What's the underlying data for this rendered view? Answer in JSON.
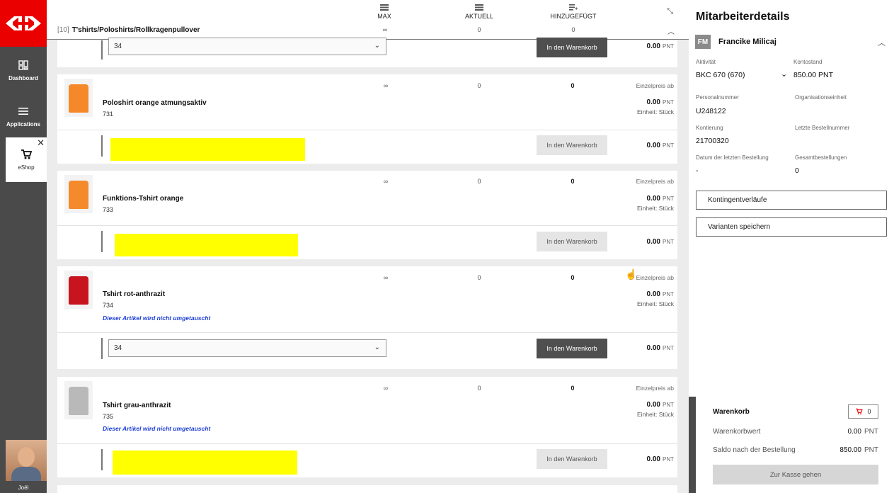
{
  "sidebar": {
    "items": [
      {
        "label": "Dashboard",
        "icon": "dashboard-icon"
      },
      {
        "label": "Applications",
        "icon": "menu-icon"
      },
      {
        "label": "eShop",
        "icon": "cart-icon"
      }
    ],
    "user_name": "Joël"
  },
  "columns": {
    "max": "MAX",
    "aktuell": "AKTUELL",
    "hinzugefuegt": "HINZUGEFÜGT"
  },
  "category": {
    "count": "[10]",
    "title": "T'shirts/Poloshirts/Rollkragenpullover",
    "max": "∞",
    "aktuell": "0",
    "hinzugefuegt": "0"
  },
  "top_partial": {
    "select_value": "34",
    "button": "In den Warenkorb",
    "price": "0.00",
    "unit": "PNT"
  },
  "products": [
    {
      "name": "Poloshirt orange atmungsaktiv",
      "number": "731",
      "max": "∞",
      "aktuell": "0",
      "hinzugefuegt": "0",
      "price_label": "Einzelpreis ab",
      "price": "0.00",
      "currency": "PNT",
      "unit": "Einheit: Stück",
      "note": "",
      "button": "In den Warenkorb",
      "line_price": "0.00",
      "color": "#f5892a"
    },
    {
      "name": "Funktions-Tshirt orange",
      "number": "733",
      "max": "∞",
      "aktuell": "0",
      "hinzugefuegt": "0",
      "price_label": "Einzelpreis ab",
      "price": "0.00",
      "currency": "PNT",
      "unit": "Einheit: Stück",
      "note": "",
      "button": "In den Warenkorb",
      "line_price": "0.00",
      "color": "#f58a2c"
    },
    {
      "name": "Tshirt rot-anthrazit",
      "number": "734",
      "max": "∞",
      "aktuell": "0",
      "hinzugefuegt": "0",
      "price_label": "Einzelpreis ab",
      "price": "0.00",
      "currency": "PNT",
      "unit": "Einheit: Stück",
      "note": "Dieser Artikel wird nicht umgetauscht",
      "button": "In den Warenkorb",
      "select_value": "34",
      "line_price": "0.00",
      "color": "#c8141e"
    },
    {
      "name": "Tshirt grau-anthrazit",
      "number": "735",
      "max": "∞",
      "aktuell": "0",
      "hinzugefuegt": "0",
      "price_label": "Einzelpreis ab",
      "price": "0.00",
      "currency": "PNT",
      "unit": "Einheit: Stück",
      "note": "Dieser Artikel wird nicht umgetauscht",
      "button": "In den Warenkorb",
      "line_price": "0.00",
      "color": "#b9b9b9"
    }
  ],
  "panel": {
    "title": "Mitarbeiterdetails",
    "initials": "FM",
    "employee_name": "Francike  Milicaj",
    "aktivitaet_label": "Aktivität",
    "aktivitaet_value": "BKC 670 (670)",
    "kontostand_label": "Kontostand",
    "kontostand_value": "850.00  PNT",
    "personalnummer_label": "Personalnummer",
    "personalnummer_value": "U248122",
    "organisationseinheit_label": "Organisationseinheit",
    "organisationseinheit_value": "",
    "kontierung_label": "Kontierung",
    "kontierung_value": "21700320",
    "letzte_bestellnummer_label": "Letzte Bestellnummer",
    "letzte_bestellnummer_value": "",
    "datum_label": "Datum der letzten Bestellung",
    "datum_value": "-",
    "gesamt_label": "Gesamtbestellungen",
    "gesamt_value": "0",
    "btn_kontingent": "Kontingentverläufe",
    "btn_varianten": "Varianten speichern"
  },
  "cart": {
    "title": "Warenkorb",
    "count": "0",
    "wert_label": "Warenkorbwert",
    "wert_value": "0.00",
    "saldo_label": "Saldo nach der Bestellung",
    "saldo_value": "850.00",
    "currency": "PNT",
    "checkout": "Zur Kasse gehen"
  },
  "colors": {
    "brand_red": "#eb0000",
    "sidebar": "#4a4a4a",
    "highlight_yellow": "#ffff00",
    "note_blue": "#1d3fd6"
  }
}
